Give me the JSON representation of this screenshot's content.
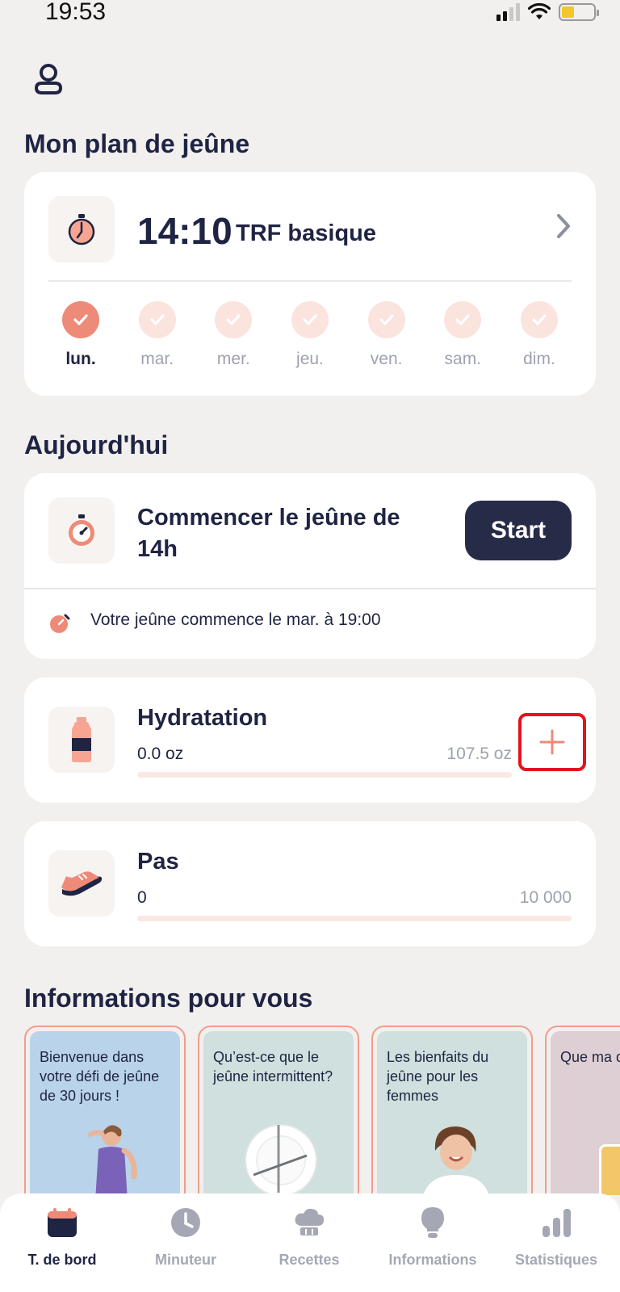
{
  "status_bar": {
    "time": "19:53"
  },
  "plan": {
    "section_title": "Mon plan de jeûne",
    "ratio": "14:10",
    "name": "TRF basique",
    "days": [
      {
        "label": "lun.",
        "active": true
      },
      {
        "label": "mar.",
        "active": false
      },
      {
        "label": "mer.",
        "active": false
      },
      {
        "label": "jeu.",
        "active": false
      },
      {
        "label": "ven.",
        "active": false
      },
      {
        "label": "sam.",
        "active": false
      },
      {
        "label": "dim.",
        "active": false
      }
    ]
  },
  "today": {
    "section_title": "Aujourd'hui",
    "fast_title": "Commencer le jeûne de 14h",
    "start_label": "Start",
    "fast_info": "Votre jeûne commence le mar. à 19:00"
  },
  "hydration": {
    "title": "Hydratation",
    "current": "0.0 oz",
    "goal": "107.5 oz",
    "progress": 0
  },
  "steps": {
    "title": "Pas",
    "current": "0",
    "goal": "10 000",
    "progress": 0
  },
  "info": {
    "section_title": "Informations pour vous",
    "cards": [
      {
        "text": "Bienvenue dans votre défi de jeûne de 30 jours !",
        "bg": "#b9d3ea"
      },
      {
        "text": "Qu’est-ce que le jeûne intermittent?",
        "bg": "#cfe0de"
      },
      {
        "text": "Les bienfaits du jeûne pour les femmes",
        "bg": "#cfe0de"
      },
      {
        "text": "Que ma de jeûn",
        "bg": "#ddcfd3"
      }
    ]
  },
  "tabs": [
    {
      "label": "T. de bord",
      "icon": "calendar-icon",
      "active": true
    },
    {
      "label": "Minuteur",
      "icon": "clock-icon",
      "active": false
    },
    {
      "label": "Recettes",
      "icon": "chef-hat-icon",
      "active": false
    },
    {
      "label": "Informations",
      "icon": "lightbulb-icon",
      "active": false
    },
    {
      "label": "Statistiques",
      "icon": "bar-chart-icon",
      "active": false
    }
  ],
  "colors": {
    "accent": "#ee8a78",
    "accent_light": "#fbe3de",
    "navy": "#1f2443",
    "highlight": "#e5121b"
  }
}
